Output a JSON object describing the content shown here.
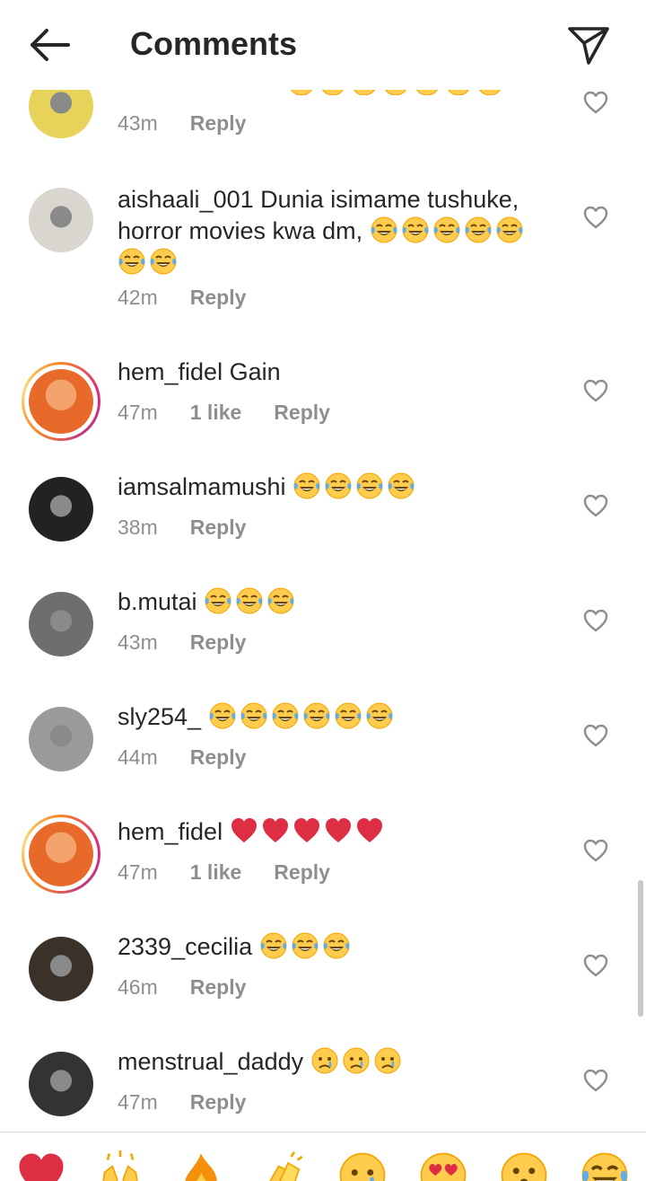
{
  "header": {
    "title": "Comments",
    "back_icon": "arrow-left-icon",
    "send_icon": "paper-plane-icon"
  },
  "colors": {
    "text": "#262626",
    "meta": "#8e8e8e",
    "heart": "#e0245e"
  },
  "comments": [
    {
      "username": "",
      "text": "",
      "time": "43m",
      "likes": "",
      "reply": "Reply",
      "emoji": [
        "laugh-cry",
        "laugh-cry",
        "laugh-cry",
        "laugh-cry",
        "laugh-cry",
        "laugh-cry",
        "laugh-cry"
      ]
    },
    {
      "username": "aishaali_001",
      "text": "Dunia isimame tushuke, horror movies kwa dm,",
      "time": "42m",
      "likes": "",
      "reply": "Reply",
      "emoji": [
        "laugh-cry",
        "laugh-cry",
        "laugh-cry",
        "laugh-cry",
        "laugh-cry",
        "laugh-cry",
        "laugh-cry"
      ]
    },
    {
      "username": "hem_fidel",
      "text": "Gain",
      "time": "47m",
      "likes": "1 like",
      "reply": "Reply",
      "emoji": []
    },
    {
      "username": "iamsalmamushi",
      "text": "",
      "time": "38m",
      "likes": "",
      "reply": "Reply",
      "emoji": [
        "laugh-cry",
        "laugh-cry",
        "laugh-cry",
        "laugh-cry"
      ]
    },
    {
      "username": "b.mutai",
      "text": "",
      "time": "43m",
      "likes": "",
      "reply": "Reply",
      "emoji": [
        "laugh-cry",
        "laugh-cry",
        "laugh-cry"
      ]
    },
    {
      "username": "sly254_",
      "text": "",
      "time": "44m",
      "likes": "",
      "reply": "Reply",
      "emoji": [
        "laugh-cry",
        "laugh-cry",
        "laugh-cry",
        "laugh-cry",
        "laugh-cry",
        "laugh-cry"
      ]
    },
    {
      "username": "hem_fidel",
      "text": "",
      "time": "47m",
      "likes": "1 like",
      "reply": "Reply",
      "emoji": [
        "red-heart",
        "red-heart",
        "red-heart",
        "red-heart",
        "red-heart"
      ]
    },
    {
      "username": "2339_cecilia",
      "text": "",
      "time": "46m",
      "likes": "",
      "reply": "Reply",
      "emoji": [
        "laugh-cry",
        "laugh-cry",
        "laugh-cry"
      ]
    },
    {
      "username": "menstrual_daddy",
      "text": "",
      "time": "47m",
      "likes": "",
      "reply": "Reply",
      "emoji": [
        "crying-face",
        "crying-face",
        "crying-face"
      ]
    }
  ],
  "quick_reactions": [
    "red-heart",
    "raising-hands",
    "fire",
    "clapping-hands",
    "crying-face",
    "heart-eyes",
    "astonished-face",
    "laugh-cry"
  ]
}
